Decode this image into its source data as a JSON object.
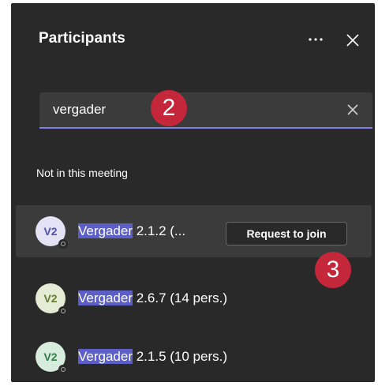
{
  "panel": {
    "title": "Participants",
    "more_icon": "more-horizontal-icon",
    "close_icon": "close-icon"
  },
  "search": {
    "value": "vergader",
    "clear_icon": "clear-icon"
  },
  "callouts": [
    "2",
    "3"
  ],
  "section_label": "Not in this meeting",
  "rows": [
    {
      "avatar": "V2",
      "highlight": "Vergader",
      "rest": " 2.1.2 (...",
      "action_label": "Request to join",
      "avatar_bg": "#e4e2f5",
      "avatar_fg": "#4f52b2"
    },
    {
      "avatar": "V2",
      "highlight": "Vergader",
      "rest": " 2.6.7 (14 pers.)",
      "avatar_bg": "#e5ecd6",
      "avatar_fg": "#627b2f"
    },
    {
      "avatar": "V2",
      "highlight": "Vergader",
      "rest": " 2.1.5 (10 pers.)",
      "avatar_bg": "#d8ecde",
      "avatar_fg": "#2e7d47"
    }
  ],
  "colors": {
    "panel_bg": "#292929",
    "accent": "#7b83eb",
    "highlight": "#5b5fc7",
    "callout": "#c4263a"
  }
}
